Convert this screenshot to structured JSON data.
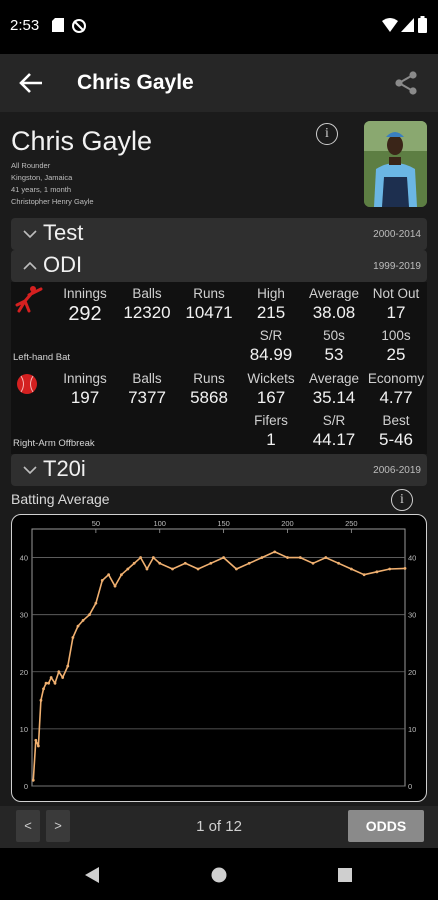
{
  "status": {
    "time": "2:53"
  },
  "appbar": {
    "title": "Chris Gayle"
  },
  "profile": {
    "name": "Chris Gayle",
    "role": "All Rounder",
    "birthplace": "Kingston, Jamaica",
    "age": "41 years, 1 month",
    "full_name": "Christopher Henry Gayle"
  },
  "formats": {
    "test": {
      "name": "Test",
      "years": "2000-2014",
      "chevron": "chevron-down"
    },
    "odi": {
      "name": "ODI",
      "years": "1999-2019",
      "chevron": "chevron-up"
    },
    "t20i": {
      "name": "T20i",
      "years": "2006-2019",
      "chevron": "chevron-down"
    }
  },
  "odi_batting": {
    "style": "Left-hand Bat",
    "innings": {
      "label": "Innings",
      "value": "292"
    },
    "balls": {
      "label": "Balls",
      "value": "12320"
    },
    "runs": {
      "label": "Runs",
      "value": "10471"
    },
    "high": {
      "label": "High",
      "value": "215"
    },
    "average": {
      "label": "Average",
      "value": "38.08"
    },
    "not_out": {
      "label": "Not Out",
      "value": "17"
    },
    "sr": {
      "label": "S/R",
      "value": "84.99"
    },
    "fifties": {
      "label": "50s",
      "value": "53"
    },
    "hundreds": {
      "label": "100s",
      "value": "25"
    }
  },
  "odi_bowling": {
    "style": "Right-Arm Offbreak",
    "innings": {
      "label": "Innings",
      "value": "197"
    },
    "balls": {
      "label": "Balls",
      "value": "7377"
    },
    "runs": {
      "label": "Runs",
      "value": "5868"
    },
    "wickets": {
      "label": "Wickets",
      "value": "167"
    },
    "average": {
      "label": "Average",
      "value": "35.14"
    },
    "economy": {
      "label": "Economy",
      "value": "4.77"
    },
    "fifers": {
      "label": "Fifers",
      "value": "1"
    },
    "sr": {
      "label": "S/R",
      "value": "44.17"
    },
    "best": {
      "label": "Best",
      "value": "5-46"
    }
  },
  "graph": {
    "title": "Batting Average"
  },
  "chart_data": {
    "type": "line",
    "title": "",
    "xlabel": "",
    "ylabel": "",
    "xlim": [
      0,
      292
    ],
    "ylim": [
      0,
      45
    ],
    "x_ticks": [
      50,
      100,
      150,
      200,
      250
    ],
    "y_ticks": [
      0,
      10,
      20,
      30,
      40
    ],
    "line_color": "#f0b070",
    "series": [
      {
        "x": [
          1,
          3,
          5,
          7,
          9,
          11,
          13,
          15,
          18,
          21,
          24,
          28,
          32,
          36,
          40,
          45,
          50,
          55,
          60,
          65,
          70,
          75,
          80,
          85,
          90,
          95,
          100,
          110,
          120,
          130,
          140,
          150,
          160,
          170,
          180,
          190,
          200,
          210,
          220,
          230,
          240,
          250,
          260,
          270,
          280,
          292
        ],
        "y": [
          1,
          8,
          7,
          15,
          17,
          18,
          18,
          19,
          18,
          20,
          19,
          21,
          26,
          28,
          29,
          30,
          32,
          36,
          37,
          35,
          37,
          38,
          39,
          40,
          38,
          40,
          39,
          38,
          39,
          38,
          39,
          40,
          38,
          39,
          40,
          41,
          40,
          40,
          39,
          40,
          39,
          38,
          37,
          37.5,
          38,
          38.1
        ]
      }
    ]
  },
  "pager": {
    "prev": "<",
    "next": ">",
    "page_text": "1 of 12",
    "odds": "ODDS"
  },
  "colors": {
    "background": "#1b1b1b",
    "appbar": "#262626",
    "line": "#f0b070",
    "ball_red": "#d42020"
  }
}
